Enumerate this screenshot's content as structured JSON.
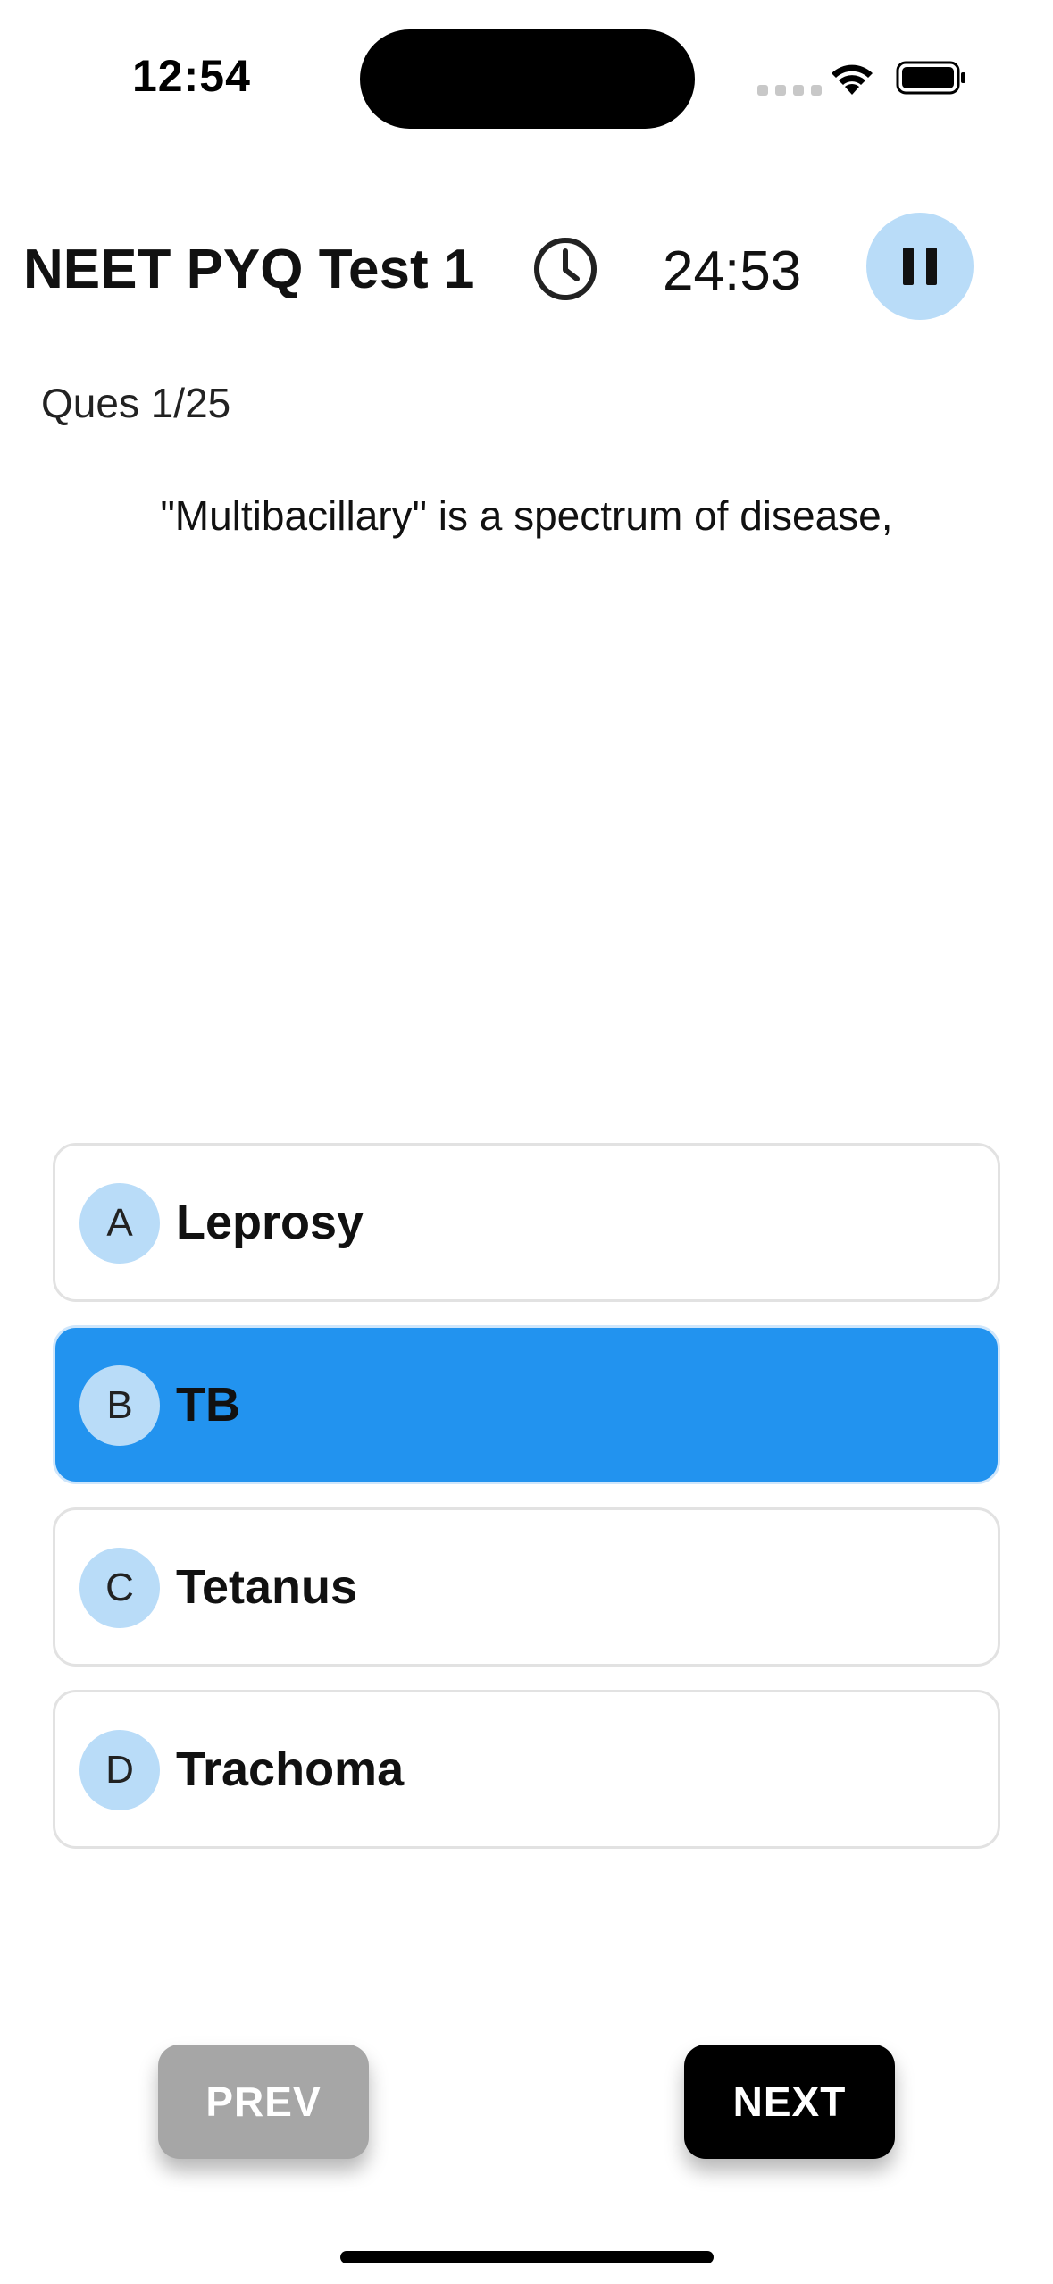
{
  "status_bar": {
    "time": "12:54"
  },
  "header": {
    "title": "NEET PYQ Test 1",
    "timer": "24:53",
    "pause_icon": "pause-icon",
    "clock_icon": "clock-icon"
  },
  "question": {
    "number_label": "Ques 1/25",
    "text": "\"Multibacillary\" is a spectrum of disease,"
  },
  "options": [
    {
      "letter": "A",
      "label": "Leprosy",
      "selected": false
    },
    {
      "letter": "B",
      "label": "TB",
      "selected": true
    },
    {
      "letter": "C",
      "label": "Tetanus",
      "selected": false
    },
    {
      "letter": "D",
      "label": "Trachoma",
      "selected": false
    }
  ],
  "navigation": {
    "prev_label": "PREV",
    "next_label": "NEXT"
  },
  "colors": {
    "selected_option": "#2293ef",
    "letter_badge": "#b9dcf8",
    "pause_button": "#b9dcf8",
    "prev_disabled": "#a6a6a6",
    "next": "#000000"
  }
}
